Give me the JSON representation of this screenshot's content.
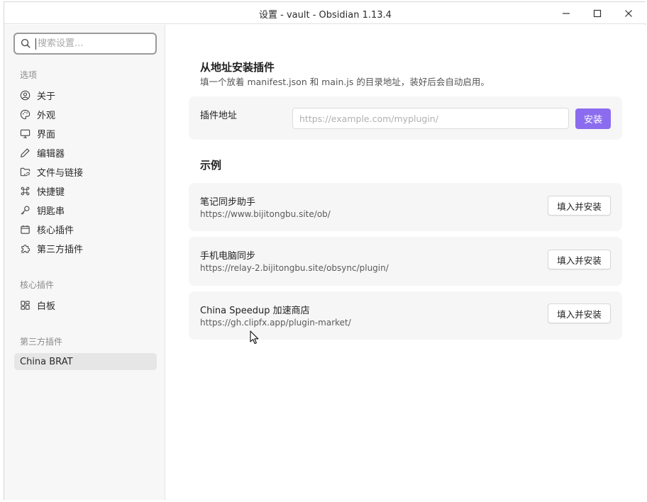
{
  "window": {
    "title": "设置 - vault - Obsidian 1.13.4",
    "controls": [
      "minimize-icon",
      "maximize-icon",
      "close-icon"
    ]
  },
  "sidebar": {
    "search": {
      "placeholder": "搜索设置...",
      "value": ""
    },
    "options_label": "选项",
    "options": [
      {
        "label": "关于",
        "icon": "user-circle-icon"
      },
      {
        "label": "外观",
        "icon": "palette-icon"
      },
      {
        "label": "界面",
        "icon": "monitor-icon"
      },
      {
        "label": "编辑器",
        "icon": "pencil-icon"
      },
      {
        "label": "文件与链接",
        "icon": "folder-link-icon"
      },
      {
        "label": "快捷键",
        "icon": "command-icon"
      },
      {
        "label": "钥匙串",
        "icon": "key-icon"
      },
      {
        "label": "核心插件",
        "icon": "calendar-box-icon"
      },
      {
        "label": "第三方插件",
        "icon": "puzzle-icon"
      }
    ],
    "core_plugins_label": "核心插件",
    "core_plugins": [
      {
        "label": "白板",
        "icon": "canvas-grid-icon"
      }
    ],
    "community_plugins_label": "第三方插件",
    "community_plugins": [
      {
        "label": "China BRAT",
        "active": true
      }
    ]
  },
  "main": {
    "install_heading": "从地址安装插件",
    "install_description": "填一个放着 manifest.json 和 main.js 的目录地址，装好后会自动启用。",
    "url_field": {
      "label": "插件地址",
      "placeholder": "https://example.com/myplugin/",
      "value": ""
    },
    "install_button": "安装",
    "examples_heading": "示例",
    "examples": [
      {
        "name": "笔记同步助手",
        "url": "https://www.bijitongbu.site/ob/",
        "button": "填入并安装"
      },
      {
        "name": "手机电脑同步",
        "url": "https://relay-2.bijitongbu.site/obsync/plugin/",
        "button": "填入并安装"
      },
      {
        "name": "China Speedup 加速商店",
        "url": "https://gh.clipfx.app/plugin-market/",
        "button": "填入并安装"
      }
    ]
  },
  "colors": {
    "accent": "#8b6cef",
    "sidebar_bg": "#f7f7f7",
    "card_bg": "#f6f6f6",
    "active_item_bg": "#e6e6e6"
  }
}
